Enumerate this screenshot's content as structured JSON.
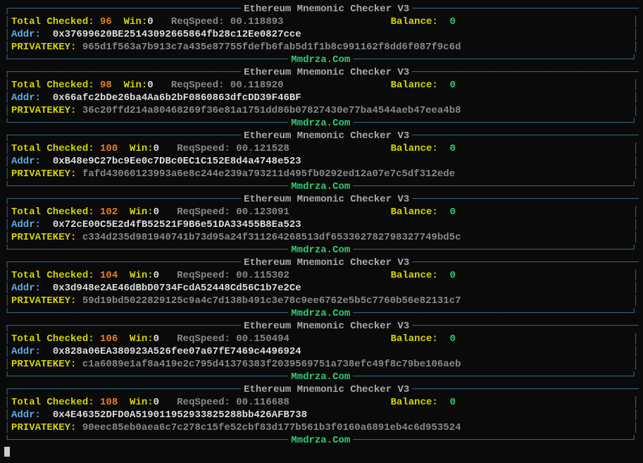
{
  "title": "Ethereum Mnemonic Checker V3",
  "footer": "Mmdrza.Com",
  "labels": {
    "totalChecked": "Total Checked:",
    "win": "Win:",
    "reqSpeed": "ReqSpeed:",
    "balance": "Balance:",
    "addr": "Addr:",
    "privateKey": "PRIVATEKEY:"
  },
  "blocks": [
    {
      "checked": "96",
      "win": "0",
      "reqSpeed": "00.118893",
      "balance": "0",
      "addr": "0x37699620BE25143092665864fb28c12Ee0827cce",
      "privateKey": "965d1f563a7b913c7a435e87755fdefb6fab5d1f1b8c991162f8dd6f087f9c6d"
    },
    {
      "checked": "98",
      "win": "0",
      "reqSpeed": "00.118920",
      "balance": "0",
      "addr": "0x66afc2bDe26ba4Aa6b2bF0860863dfcDD39F46BF",
      "privateKey": "36c20ffd214a80468269f36e81a1751dd86b07827430e77ba4544aeb47eea4b8"
    },
    {
      "checked": "100",
      "win": "0",
      "reqSpeed": "00.121528",
      "balance": "0",
      "addr": "0xB48e9C27bc9Ee0c7DBc0EC1C152E8d4a4748e523",
      "privateKey": "fafd43060123993a6e8c244e239a793211d495fb0292ed12a07e7c5df312ede"
    },
    {
      "checked": "102",
      "win": "0",
      "reqSpeed": "00.123091",
      "balance": "0",
      "addr": "0x72cE00C5E2d4fB52521F9B6e51DA33455B8Ea523",
      "privateKey": "c334d235d981940741b73d95a24f311264268513df653362782798327749bd5c"
    },
    {
      "checked": "104",
      "win": "0",
      "reqSpeed": "00.115302",
      "balance": "0",
      "addr": "0x3d948e2AE46dBbD0734FcdA52448Cd56C1b7e2Ce",
      "privateKey": "59d19bd5022829125c9a4c7d138b491c3e78c9ee6762e5b5c7760b56e82131c7"
    },
    {
      "checked": "106",
      "win": "0",
      "reqSpeed": "00.150494",
      "balance": "0",
      "addr": "0x828a06EA380923A526fee07a67fE7469c4496924",
      "privateKey": "c1a6089e1af8a419e2c795d41376383f2039569751a738efc49f8c79be106aeb"
    },
    {
      "checked": "108",
      "win": "0",
      "reqSpeed": "00.116688",
      "balance": "0",
      "addr": "0x4E46352DFD0A519011952933825288bb426AFB738",
      "privateKey": "90eec85eb0aea6c7c278c15fe52cbf83d177b561b3f0160a6891eb4c6d953524"
    }
  ]
}
